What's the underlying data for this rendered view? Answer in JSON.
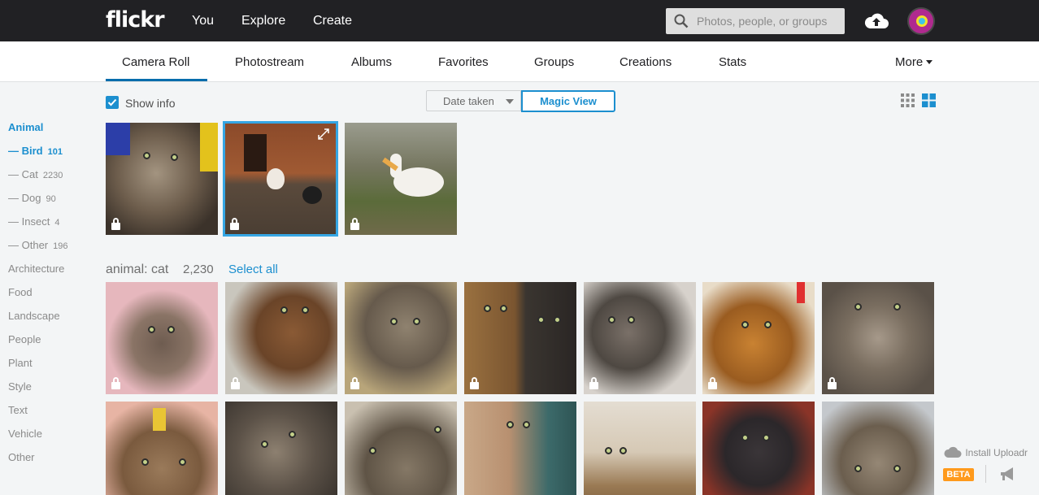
{
  "topbar": {
    "logo": "flickr",
    "nav": [
      "You",
      "Explore",
      "Create"
    ],
    "search_placeholder": "Photos, people, or groups"
  },
  "subnav": {
    "tabs": [
      "Camera Roll",
      "Photostream",
      "Albums",
      "Favorites",
      "Groups",
      "Creations",
      "Stats"
    ],
    "more": "More",
    "active": "Camera Roll"
  },
  "controls": {
    "show_info": "Show info",
    "date_taken": "Date taken",
    "magic_view": "Magic View"
  },
  "sidebar": {
    "head": "Animal",
    "subitems": [
      {
        "label": "Bird",
        "count": "101"
      },
      {
        "label": "Cat",
        "count": "2230"
      },
      {
        "label": "Dog",
        "count": "90"
      },
      {
        "label": "Insect",
        "count": "4"
      },
      {
        "label": "Other",
        "count": "196"
      }
    ],
    "categories": [
      "Architecture",
      "Food",
      "Landscape",
      "People",
      "Plant",
      "Style",
      "Text",
      "Vehicle",
      "Other"
    ]
  },
  "section": {
    "title": "animal: cat",
    "count": "2,230",
    "select_all": "Select all"
  },
  "uploadr": {
    "install": "Install Uploadr",
    "beta": "BETA"
  },
  "colors": {
    "accent": "#1c8fcf",
    "topbar": "#212124",
    "beta": "#ff9a1c"
  }
}
